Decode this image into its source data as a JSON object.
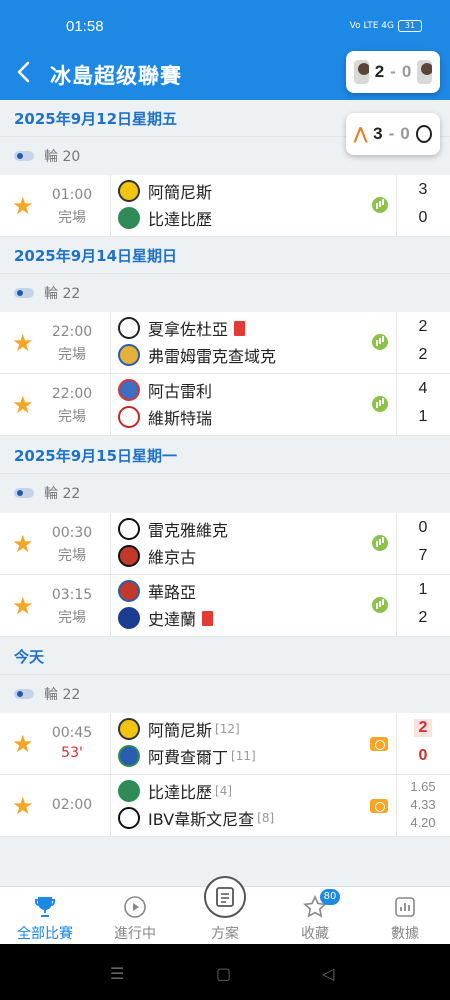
{
  "status_bar": {
    "time": "01:58",
    "signal": "Vo LTE 4G",
    "battery": "31"
  },
  "header": {
    "title": "冰島超级聯賽"
  },
  "live_cards": [
    {
      "home_score": "2",
      "away_score": "0"
    },
    {
      "home_score": "3",
      "away_score": "0"
    }
  ],
  "sections": [
    {
      "date": "2025年9月12日星期五",
      "round": "輪 20",
      "matches": [
        {
          "time": "01:00",
          "status": "完場",
          "home": "阿簡尼斯",
          "away": "比達比歷",
          "home_score": "3",
          "away_score": "0"
        }
      ]
    },
    {
      "date": "2025年9月14日星期日",
      "round": "輪 22",
      "matches": [
        {
          "time": "22:00",
          "status": "完場",
          "home": "夏拿佐杜亞",
          "away": "弗雷姆雷克查域克",
          "home_score": "2",
          "away_score": "2"
        },
        {
          "time": "22:00",
          "status": "完場",
          "home": "阿古雷利",
          "away": "維斯特瑞",
          "home_score": "4",
          "away_score": "1"
        }
      ]
    },
    {
      "date": "2025年9月15日星期一",
      "round": "輪 22",
      "matches": [
        {
          "time": "00:30",
          "status": "完場",
          "home": "雷克雅維克",
          "away": "維京古",
          "home_score": "0",
          "away_score": "7"
        },
        {
          "time": "03:15",
          "status": "完場",
          "home": "華路亞",
          "away": "史達蘭",
          "home_score": "1",
          "away_score": "2"
        }
      ]
    },
    {
      "date": "今天",
      "round": "輪 22",
      "matches": [
        {
          "time": "00:45",
          "status": "53'",
          "home": "阿簡尼斯",
          "home_rank": "[12]",
          "away": "阿費查爾丁",
          "away_rank": "[11]",
          "home_score": "2",
          "away_score": "0"
        },
        {
          "time": "02:00",
          "status": "",
          "home": "比達比歷",
          "home_rank": "[4]",
          "away": "IBV韋斯文尼查",
          "away_rank": "[8]",
          "odds": [
            "1.65",
            "4.33",
            "4.20"
          ]
        }
      ]
    }
  ],
  "bottom_nav": [
    {
      "label": "全部比賽",
      "icon": "trophy-icon"
    },
    {
      "label": "進行中",
      "icon": "play-icon"
    },
    {
      "label": "方案",
      "icon": "document-icon"
    },
    {
      "label": "收藏",
      "icon": "star-icon",
      "badge": "80"
    },
    {
      "label": "數據",
      "icon": "chart-icon"
    }
  ],
  "colors": {
    "primary": "#1e88e5",
    "star": "#f5a623",
    "live": "#d32f2f"
  }
}
